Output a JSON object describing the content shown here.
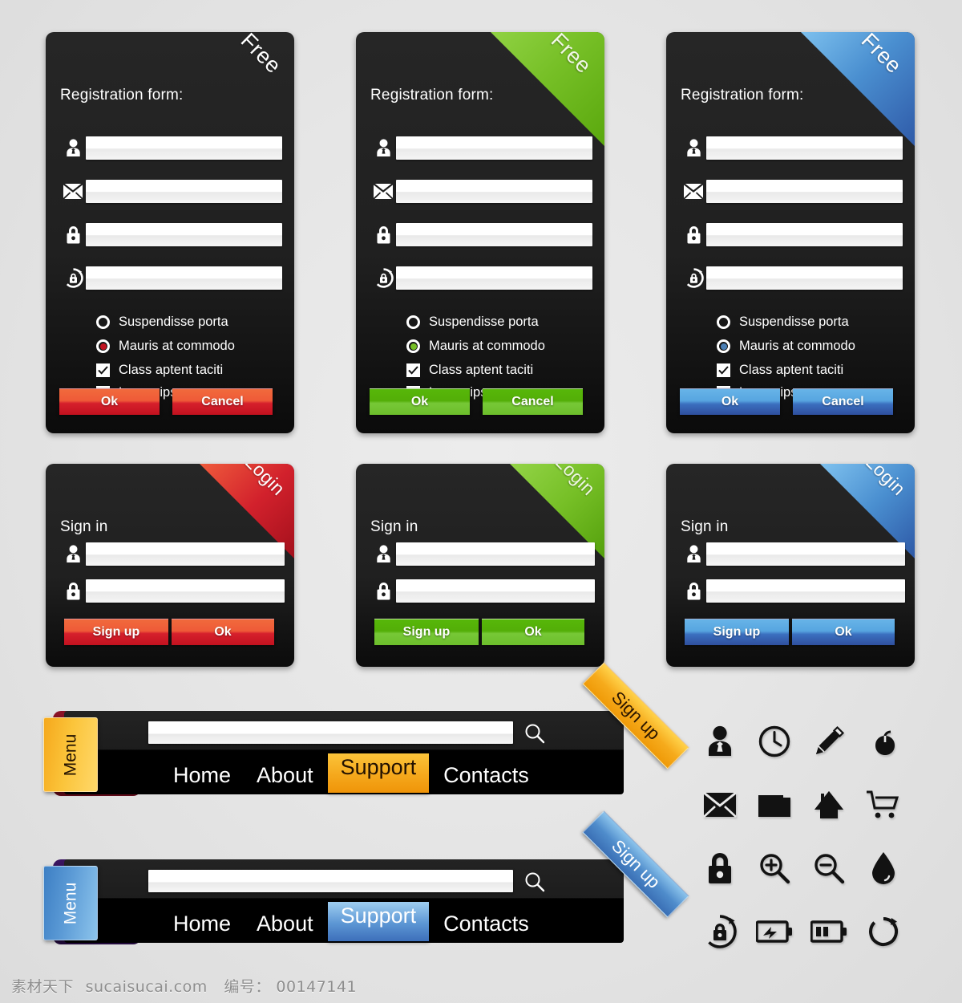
{
  "background_color": "#e6e6e6",
  "themes": {
    "red": {
      "name": "red",
      "accent": "#d21f2b",
      "ribbon_from": "#e8354a",
      "ribbon_to": "#a50f1c",
      "radio_dot": "#c1121f"
    },
    "green": {
      "name": "green",
      "accent": "#76bf26",
      "ribbon_from": "#83c83a",
      "ribbon_to": "#5aa80d",
      "radio_dot": "#76bf26"
    },
    "blue": {
      "name": "blue",
      "accent": "#3d78c0",
      "ribbon_from": "#6fb5e6",
      "ribbon_to": "#2f5aa8",
      "radio_dot": "#4a7fb5"
    }
  },
  "registration_forms": [
    {
      "theme": "red",
      "ribbon_label": "Free",
      "title": "Registration form:",
      "fields": [
        {
          "icon": "user-icon",
          "value": "",
          "placeholder": ""
        },
        {
          "icon": "envelope-icon",
          "value": "",
          "placeholder": ""
        },
        {
          "icon": "lock-icon",
          "value": "",
          "placeholder": ""
        },
        {
          "icon": "lock-refresh-icon",
          "value": "",
          "placeholder": ""
        }
      ],
      "choices": [
        {
          "type": "radio",
          "label": "Suspendisse porta",
          "checked": false
        },
        {
          "type": "radio",
          "label": "Mauris at commodo",
          "checked": true
        },
        {
          "type": "checkbox",
          "label": "Class aptent taciti",
          "checked": true
        },
        {
          "type": "checkbox",
          "label": "Lorem ipsum",
          "checked": true
        }
      ],
      "buttons": [
        {
          "label": "Ok"
        },
        {
          "label": "Cancel"
        }
      ]
    },
    {
      "theme": "green",
      "ribbon_label": "Free",
      "title": "Registration form:",
      "fields": [
        {
          "icon": "user-icon",
          "value": "",
          "placeholder": ""
        },
        {
          "icon": "envelope-icon",
          "value": "",
          "placeholder": ""
        },
        {
          "icon": "lock-icon",
          "value": "",
          "placeholder": ""
        },
        {
          "icon": "lock-refresh-icon",
          "value": "",
          "placeholder": ""
        }
      ],
      "choices": [
        {
          "type": "radio",
          "label": "Suspendisse porta",
          "checked": false
        },
        {
          "type": "radio",
          "label": "Mauris at commodo",
          "checked": true
        },
        {
          "type": "checkbox",
          "label": "Class aptent taciti",
          "checked": true
        },
        {
          "type": "checkbox",
          "label": "Lorem ipsum",
          "checked": true
        }
      ],
      "buttons": [
        {
          "label": "Ok"
        },
        {
          "label": "Cancel"
        }
      ]
    },
    {
      "theme": "blue",
      "ribbon_label": "Free",
      "title": "Registration form:",
      "fields": [
        {
          "icon": "user-icon",
          "value": "",
          "placeholder": ""
        },
        {
          "icon": "envelope-icon",
          "value": "",
          "placeholder": ""
        },
        {
          "icon": "lock-icon",
          "value": "",
          "placeholder": ""
        },
        {
          "icon": "lock-refresh-icon",
          "value": "",
          "placeholder": ""
        }
      ],
      "choices": [
        {
          "type": "radio",
          "label": "Suspendisse porta",
          "checked": false
        },
        {
          "type": "radio",
          "label": "Mauris at commodo",
          "checked": true
        },
        {
          "type": "checkbox",
          "label": "Class aptent taciti",
          "checked": true
        },
        {
          "type": "checkbox",
          "label": "Lorem ipsum",
          "checked": true
        }
      ],
      "buttons": [
        {
          "label": "Ok"
        },
        {
          "label": "Cancel"
        }
      ]
    }
  ],
  "signin_forms": [
    {
      "theme": "red",
      "ribbon_label": "Login",
      "title": "Sign in",
      "fields": [
        {
          "icon": "user-icon",
          "value": "",
          "placeholder": ""
        },
        {
          "icon": "lock-icon",
          "value": "",
          "placeholder": ""
        }
      ],
      "buttons": [
        {
          "label": "Sign up"
        },
        {
          "label": "Ok"
        }
      ]
    },
    {
      "theme": "green",
      "ribbon_label": "Login",
      "title": "Sign in",
      "fields": [
        {
          "icon": "user-icon",
          "value": "",
          "placeholder": ""
        },
        {
          "icon": "lock-icon",
          "value": "",
          "placeholder": ""
        }
      ],
      "buttons": [
        {
          "label": "Sign up"
        },
        {
          "label": "Ok"
        }
      ]
    },
    {
      "theme": "blue",
      "ribbon_label": "Login",
      "title": "Sign in",
      "fields": [
        {
          "icon": "user-icon",
          "value": "",
          "placeholder": ""
        },
        {
          "icon": "lock-icon",
          "value": "",
          "placeholder": ""
        }
      ],
      "buttons": [
        {
          "label": "Sign up"
        },
        {
          "label": "Ok"
        }
      ]
    }
  ],
  "menubars": [
    {
      "theme": "orange",
      "menu_tab_label": "Menu",
      "ribbon_label": "Sign up",
      "search": {
        "value": "",
        "placeholder": ""
      },
      "search_icon": "search-icon",
      "nav_items": [
        {
          "label": "Home",
          "active": false
        },
        {
          "label": "About",
          "active": false
        },
        {
          "label": "Support",
          "active": true
        },
        {
          "label": "Contacts",
          "active": false
        }
      ],
      "accent": "#f5a81c",
      "accent_light": "#ffd24a",
      "edge": "#7e0d1e"
    },
    {
      "theme": "blue",
      "menu_tab_label": "Menu",
      "ribbon_label": "Sign up",
      "search": {
        "value": "",
        "placeholder": ""
      },
      "search_icon": "search-icon",
      "nav_items": [
        {
          "label": "Home",
          "active": false
        },
        {
          "label": "About",
          "active": false
        },
        {
          "label": "Support",
          "active": true
        },
        {
          "label": "Contacts",
          "active": false
        }
      ],
      "accent": "#3d7fc4",
      "accent_light": "#8cc4ec",
      "edge": "#2c0f47"
    }
  ],
  "icon_set": [
    {
      "name": "user-icon"
    },
    {
      "name": "clock-icon"
    },
    {
      "name": "pencil-icon"
    },
    {
      "name": "mouse-icon"
    },
    {
      "name": "envelope-icon"
    },
    {
      "name": "folder-icon"
    },
    {
      "name": "home-icon"
    },
    {
      "name": "cart-icon"
    },
    {
      "name": "lock-icon"
    },
    {
      "name": "zoom-in-icon"
    },
    {
      "name": "zoom-out-icon"
    },
    {
      "name": "droplet-icon"
    },
    {
      "name": "lock-refresh-icon"
    },
    {
      "name": "battery-charging-icon"
    },
    {
      "name": "battery-half-icon"
    },
    {
      "name": "refresh-icon"
    }
  ],
  "footer": {
    "site_cn": "素材天下",
    "site_url": "sucaisucai.com",
    "id_label": "编号：",
    "id_value": "00147141",
    "full": "素材天下 sucaisucai.com  编号： 00147141"
  }
}
